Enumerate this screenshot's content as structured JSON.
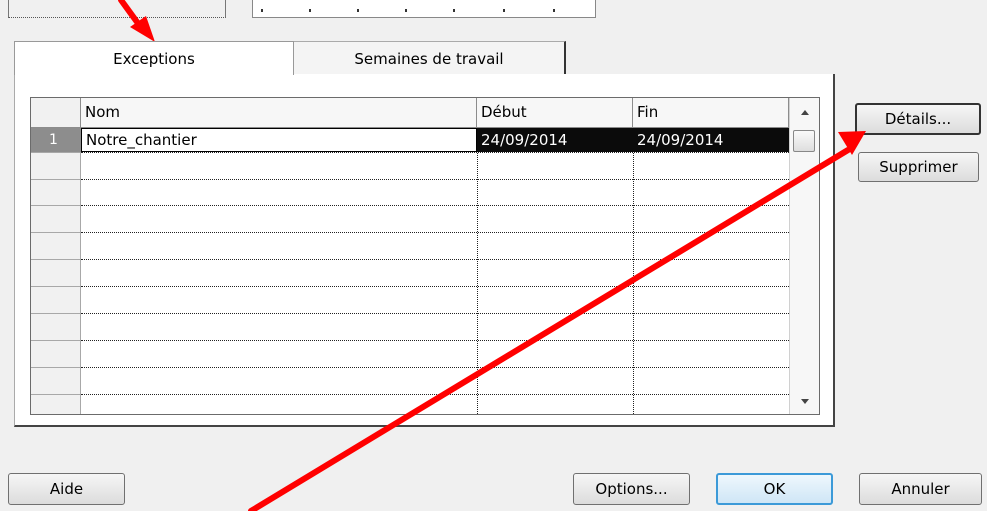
{
  "tabs": [
    {
      "label": "Exceptions",
      "active": true
    },
    {
      "label": "Semaines de travail",
      "active": false
    }
  ],
  "grid": {
    "columns": {
      "nom": "Nom",
      "debut": "Début",
      "fin": "Fin"
    },
    "rows": [
      {
        "num": "1",
        "nom": "Notre_chantier",
        "debut": "24/09/2014",
        "fin": "24/09/2014",
        "selected": true
      }
    ]
  },
  "side_buttons": {
    "details": "Détails...",
    "delete": "Supprimer"
  },
  "footer_buttons": {
    "help": "Aide",
    "options": "Options...",
    "ok": "OK",
    "cancel": "Annuler"
  },
  "colors": {
    "annotation_arrow": "#ff0000",
    "selection_dark": "#0b0b0b",
    "ok_border": "#3c9ad8"
  }
}
